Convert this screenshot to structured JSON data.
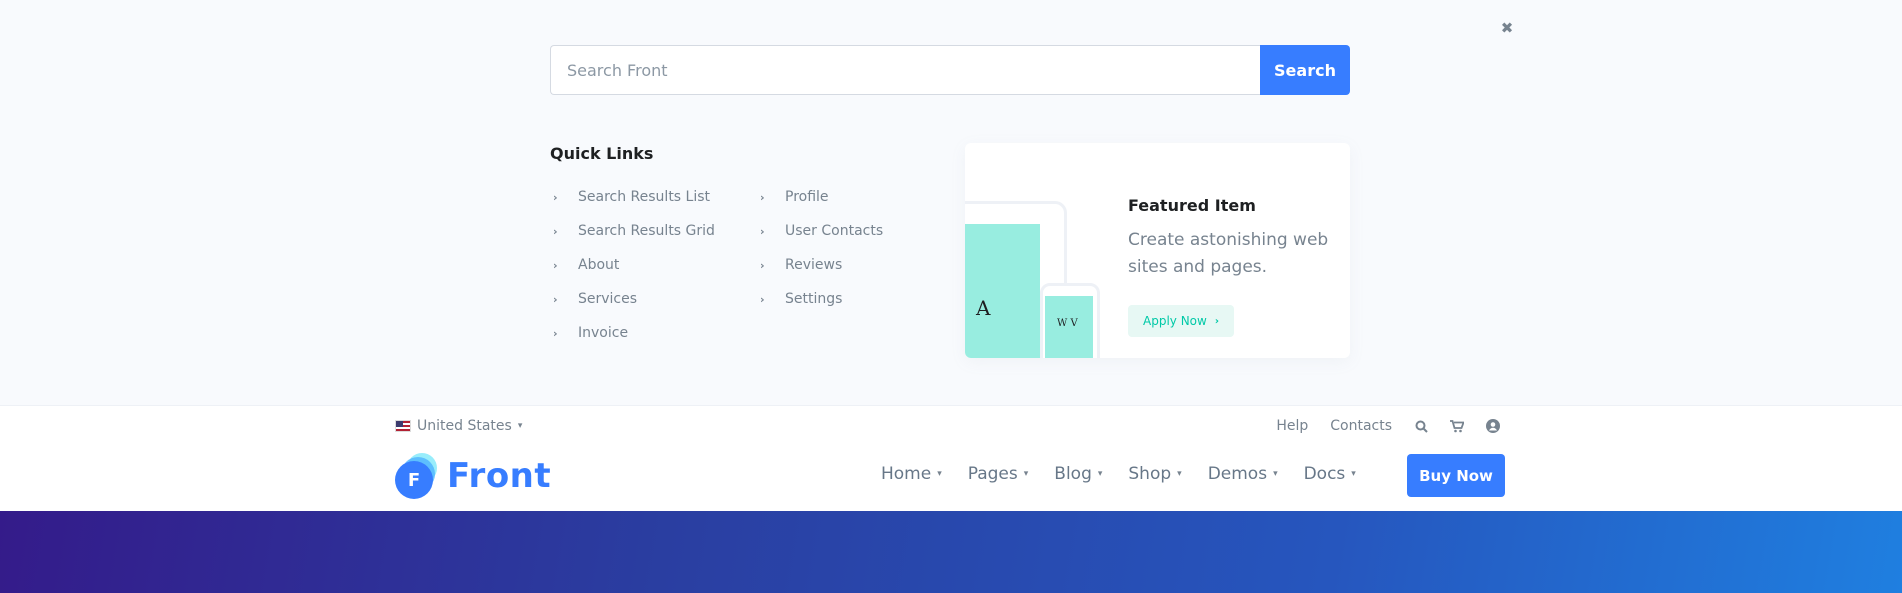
{
  "search": {
    "placeholder": "Search Front",
    "button_label": "Search",
    "close_icon": "close-icon"
  },
  "quick_links": {
    "title": "Quick Links",
    "column1": [
      "Search Results List",
      "Search Results Grid",
      "About",
      "Services",
      "Invoice"
    ],
    "column2": [
      "Profile",
      "User Contacts",
      "Reviews",
      "Settings"
    ]
  },
  "featured": {
    "title": "Featured Item",
    "text": "Create astonishing web sites and pages.",
    "button_label": "Apply Now",
    "tablet_glyph": "A",
    "phone_glyph": "W V"
  },
  "header": {
    "language": "United States",
    "top_links": [
      "Help",
      "Contacts"
    ],
    "top_icons": [
      "search-icon",
      "cart-icon",
      "user-icon"
    ],
    "logo_letter": "F",
    "logo_text": "Front",
    "nav": [
      "Home",
      "Pages",
      "Blog",
      "Shop",
      "Demos",
      "Docs"
    ],
    "buy_label": "Buy Now"
  },
  "colors": {
    "primary": "#377dff",
    "accent_teal": "#00c9a7",
    "device_screen": "#98ede0",
    "text_muted": "#77838f",
    "overlay_bg": "#f8fafd"
  }
}
